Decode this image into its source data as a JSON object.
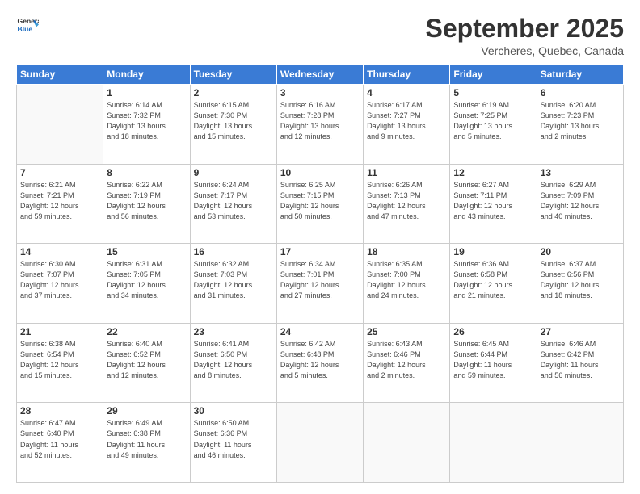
{
  "logo": {
    "line1": "General",
    "line2": "Blue"
  },
  "header": {
    "month": "September 2025",
    "location": "Vercheres, Quebec, Canada"
  },
  "weekdays": [
    "Sunday",
    "Monday",
    "Tuesday",
    "Wednesday",
    "Thursday",
    "Friday",
    "Saturday"
  ],
  "weeks": [
    [
      {
        "day": "",
        "info": ""
      },
      {
        "day": "1",
        "info": "Sunrise: 6:14 AM\nSunset: 7:32 PM\nDaylight: 13 hours\nand 18 minutes."
      },
      {
        "day": "2",
        "info": "Sunrise: 6:15 AM\nSunset: 7:30 PM\nDaylight: 13 hours\nand 15 minutes."
      },
      {
        "day": "3",
        "info": "Sunrise: 6:16 AM\nSunset: 7:28 PM\nDaylight: 13 hours\nand 12 minutes."
      },
      {
        "day": "4",
        "info": "Sunrise: 6:17 AM\nSunset: 7:27 PM\nDaylight: 13 hours\nand 9 minutes."
      },
      {
        "day": "5",
        "info": "Sunrise: 6:19 AM\nSunset: 7:25 PM\nDaylight: 13 hours\nand 5 minutes."
      },
      {
        "day": "6",
        "info": "Sunrise: 6:20 AM\nSunset: 7:23 PM\nDaylight: 13 hours\nand 2 minutes."
      }
    ],
    [
      {
        "day": "7",
        "info": "Sunrise: 6:21 AM\nSunset: 7:21 PM\nDaylight: 12 hours\nand 59 minutes."
      },
      {
        "day": "8",
        "info": "Sunrise: 6:22 AM\nSunset: 7:19 PM\nDaylight: 12 hours\nand 56 minutes."
      },
      {
        "day": "9",
        "info": "Sunrise: 6:24 AM\nSunset: 7:17 PM\nDaylight: 12 hours\nand 53 minutes."
      },
      {
        "day": "10",
        "info": "Sunrise: 6:25 AM\nSunset: 7:15 PM\nDaylight: 12 hours\nand 50 minutes."
      },
      {
        "day": "11",
        "info": "Sunrise: 6:26 AM\nSunset: 7:13 PM\nDaylight: 12 hours\nand 47 minutes."
      },
      {
        "day": "12",
        "info": "Sunrise: 6:27 AM\nSunset: 7:11 PM\nDaylight: 12 hours\nand 43 minutes."
      },
      {
        "day": "13",
        "info": "Sunrise: 6:29 AM\nSunset: 7:09 PM\nDaylight: 12 hours\nand 40 minutes."
      }
    ],
    [
      {
        "day": "14",
        "info": "Sunrise: 6:30 AM\nSunset: 7:07 PM\nDaylight: 12 hours\nand 37 minutes."
      },
      {
        "day": "15",
        "info": "Sunrise: 6:31 AM\nSunset: 7:05 PM\nDaylight: 12 hours\nand 34 minutes."
      },
      {
        "day": "16",
        "info": "Sunrise: 6:32 AM\nSunset: 7:03 PM\nDaylight: 12 hours\nand 31 minutes."
      },
      {
        "day": "17",
        "info": "Sunrise: 6:34 AM\nSunset: 7:01 PM\nDaylight: 12 hours\nand 27 minutes."
      },
      {
        "day": "18",
        "info": "Sunrise: 6:35 AM\nSunset: 7:00 PM\nDaylight: 12 hours\nand 24 minutes."
      },
      {
        "day": "19",
        "info": "Sunrise: 6:36 AM\nSunset: 6:58 PM\nDaylight: 12 hours\nand 21 minutes."
      },
      {
        "day": "20",
        "info": "Sunrise: 6:37 AM\nSunset: 6:56 PM\nDaylight: 12 hours\nand 18 minutes."
      }
    ],
    [
      {
        "day": "21",
        "info": "Sunrise: 6:38 AM\nSunset: 6:54 PM\nDaylight: 12 hours\nand 15 minutes."
      },
      {
        "day": "22",
        "info": "Sunrise: 6:40 AM\nSunset: 6:52 PM\nDaylight: 12 hours\nand 12 minutes."
      },
      {
        "day": "23",
        "info": "Sunrise: 6:41 AM\nSunset: 6:50 PM\nDaylight: 12 hours\nand 8 minutes."
      },
      {
        "day": "24",
        "info": "Sunrise: 6:42 AM\nSunset: 6:48 PM\nDaylight: 12 hours\nand 5 minutes."
      },
      {
        "day": "25",
        "info": "Sunrise: 6:43 AM\nSunset: 6:46 PM\nDaylight: 12 hours\nand 2 minutes."
      },
      {
        "day": "26",
        "info": "Sunrise: 6:45 AM\nSunset: 6:44 PM\nDaylight: 11 hours\nand 59 minutes."
      },
      {
        "day": "27",
        "info": "Sunrise: 6:46 AM\nSunset: 6:42 PM\nDaylight: 11 hours\nand 56 minutes."
      }
    ],
    [
      {
        "day": "28",
        "info": "Sunrise: 6:47 AM\nSunset: 6:40 PM\nDaylight: 11 hours\nand 52 minutes."
      },
      {
        "day": "29",
        "info": "Sunrise: 6:49 AM\nSunset: 6:38 PM\nDaylight: 11 hours\nand 49 minutes."
      },
      {
        "day": "30",
        "info": "Sunrise: 6:50 AM\nSunset: 6:36 PM\nDaylight: 11 hours\nand 46 minutes."
      },
      {
        "day": "",
        "info": ""
      },
      {
        "day": "",
        "info": ""
      },
      {
        "day": "",
        "info": ""
      },
      {
        "day": "",
        "info": ""
      }
    ]
  ]
}
